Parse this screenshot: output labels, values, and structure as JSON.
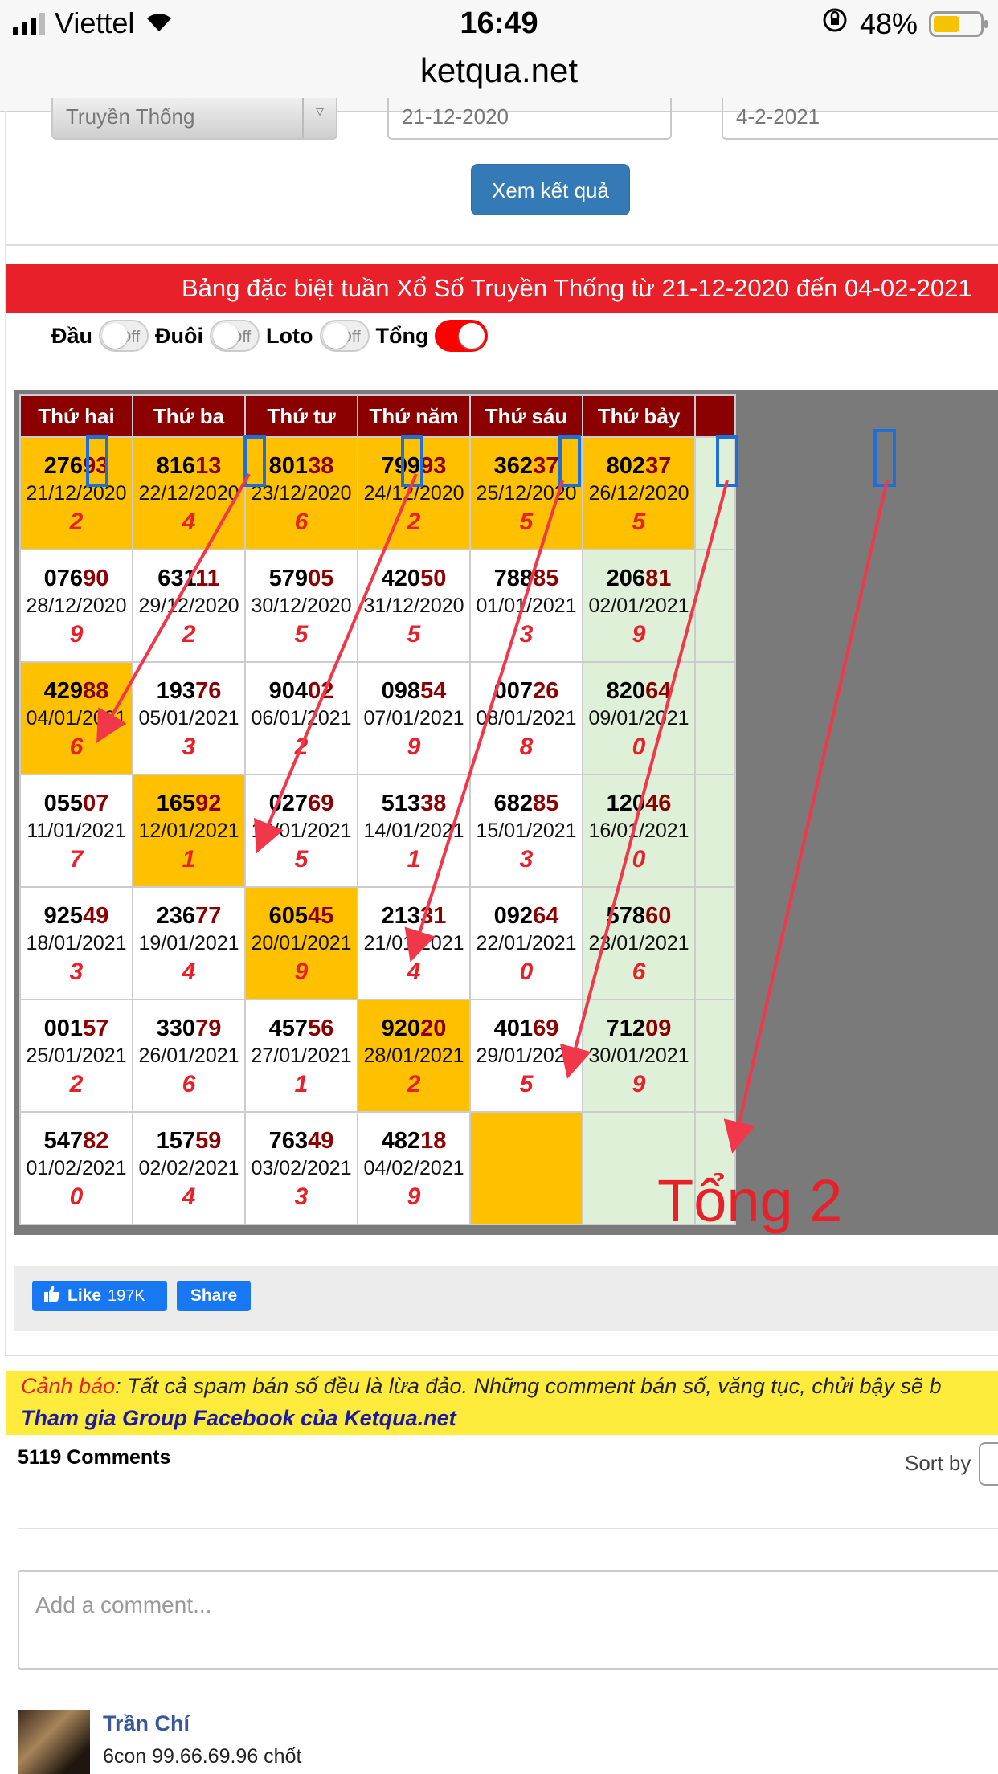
{
  "status": {
    "carrier": "Viettel",
    "time": "16:49",
    "battery": "48%",
    "battery_level": 0.48
  },
  "browser": {
    "url": "ketqua.net"
  },
  "form": {
    "type_select": "Truyền Thống",
    "date_from": "21-12-2020",
    "date_to": "4-2-2021",
    "view_button": "Xem kết quả"
  },
  "table_title": "Bảng đặc biệt tuần Xổ Số Truyền Thống từ 21-12-2020 đến 04-02-2021",
  "toggles": [
    {
      "label": "Đầu",
      "state": "Off"
    },
    {
      "label": "Đuôi",
      "state": "Off"
    },
    {
      "label": "Loto",
      "state": "Off"
    },
    {
      "label": "Tổng",
      "state": "On"
    }
  ],
  "colors": {
    "header_red": "#e8202a",
    "header_dark": "#8b0000",
    "highlight": "#ffc000",
    "weekend_green": "#dff0d8",
    "arrow": "#f0384a",
    "facebook_blue": "#1877f2"
  },
  "days": [
    "Thứ hai",
    "Thứ ba",
    "Thứ tư",
    "Thứ năm",
    "Thứ sáu",
    "Thứ bảy"
  ],
  "weeks": [
    [
      {
        "head": "276",
        "tail": "93",
        "date": "21/12/2020",
        "sum": "2",
        "hl": true
      },
      {
        "head": "816",
        "tail": "13",
        "date": "22/12/2020",
        "sum": "4",
        "hl": true
      },
      {
        "head": "801",
        "tail": "38",
        "date": "23/12/2020",
        "sum": "6",
        "hl": true
      },
      {
        "head": "799",
        "tail": "93",
        "date": "24/12/2020",
        "sum": "2",
        "hl": true
      },
      {
        "head": "362",
        "tail": "37",
        "date": "25/12/2020",
        "sum": "5",
        "hl": true
      },
      {
        "head": "802",
        "tail": "37",
        "date": "26/12/2020",
        "sum": "5",
        "hl": true
      }
    ],
    [
      {
        "head": "076",
        "tail": "90",
        "date": "28/12/2020",
        "sum": "9"
      },
      {
        "head": "631",
        "tail": "11",
        "date": "29/12/2020",
        "sum": "2"
      },
      {
        "head": "579",
        "tail": "05",
        "date": "30/12/2020",
        "sum": "5"
      },
      {
        "head": "420",
        "tail": "50",
        "date": "31/12/2020",
        "sum": "5"
      },
      {
        "head": "788",
        "tail": "85",
        "date": "01/01/2021",
        "sum": "3"
      },
      {
        "head": "206",
        "tail": "81",
        "date": "02/01/2021",
        "sum": "9",
        "gr": true
      }
    ],
    [
      {
        "head": "429",
        "tail": "88",
        "date": "04/01/2021",
        "sum": "6",
        "hl": true
      },
      {
        "head": "193",
        "tail": "76",
        "date": "05/01/2021",
        "sum": "3"
      },
      {
        "head": "904",
        "tail": "02",
        "date": "06/01/2021",
        "sum": "2"
      },
      {
        "head": "098",
        "tail": "54",
        "date": "07/01/2021",
        "sum": "9"
      },
      {
        "head": "007",
        "tail": "26",
        "date": "08/01/2021",
        "sum": "8"
      },
      {
        "head": "820",
        "tail": "64",
        "date": "09/01/2021",
        "sum": "0",
        "gr": true
      }
    ],
    [
      {
        "head": "055",
        "tail": "07",
        "date": "11/01/2021",
        "sum": "7"
      },
      {
        "head": "165",
        "tail": "92",
        "date": "12/01/2021",
        "sum": "1",
        "hl": true
      },
      {
        "head": "027",
        "tail": "69",
        "date": "13/01/2021",
        "sum": "5"
      },
      {
        "head": "513",
        "tail": "38",
        "date": "14/01/2021",
        "sum": "1"
      },
      {
        "head": "682",
        "tail": "85",
        "date": "15/01/2021",
        "sum": "3"
      },
      {
        "head": "120",
        "tail": "46",
        "date": "16/01/2021",
        "sum": "0",
        "gr": true
      }
    ],
    [
      {
        "head": "925",
        "tail": "49",
        "date": "18/01/2021",
        "sum": "3"
      },
      {
        "head": "236",
        "tail": "77",
        "date": "19/01/2021",
        "sum": "4"
      },
      {
        "head": "605",
        "tail": "45",
        "date": "20/01/2021",
        "sum": "9",
        "hl": true
      },
      {
        "head": "213",
        "tail": "31",
        "date": "21/01/2021",
        "sum": "4"
      },
      {
        "head": "092",
        "tail": "64",
        "date": "22/01/2021",
        "sum": "0"
      },
      {
        "head": "578",
        "tail": "60",
        "date": "23/01/2021",
        "sum": "6",
        "gr": true
      }
    ],
    [
      {
        "head": "001",
        "tail": "57",
        "date": "25/01/2021",
        "sum": "2"
      },
      {
        "head": "330",
        "tail": "79",
        "date": "26/01/2021",
        "sum": "6"
      },
      {
        "head": "457",
        "tail": "56",
        "date": "27/01/2021",
        "sum": "1"
      },
      {
        "head": "920",
        "tail": "20",
        "date": "28/01/2021",
        "sum": "2",
        "hl": true
      },
      {
        "head": "401",
        "tail": "69",
        "date": "29/01/2021",
        "sum": "5"
      },
      {
        "head": "712",
        "tail": "09",
        "date": "30/01/2021",
        "sum": "9",
        "gr": true
      }
    ],
    [
      {
        "head": "547",
        "tail": "82",
        "date": "01/02/2021",
        "sum": "0"
      },
      {
        "head": "157",
        "tail": "59",
        "date": "02/02/2021",
        "sum": "4"
      },
      {
        "head": "763",
        "tail": "49",
        "date": "03/02/2021",
        "sum": "3"
      },
      {
        "head": "482",
        "tail": "18",
        "date": "04/02/2021",
        "sum": "9"
      },
      {
        "empty": true,
        "hl": true
      },
      {
        "empty": true,
        "gr": true
      }
    ]
  ],
  "annotation": "Tổng 2",
  "social": {
    "like_label": "Like",
    "like_count": "197K",
    "share_label": "Share"
  },
  "warning": {
    "label": "Cảnh báo",
    "text": ": Tất cả spam bán số đều là lừa đảo. Những comment bán số, văng tục, chửi bậy sẽ b",
    "group_link": "Tham gia Group Facebook của Ketqua.net"
  },
  "comments": {
    "count": "5119 Comments",
    "sort_label": "Sort by",
    "placeholder": "Add a comment...",
    "first": {
      "author": "Trần Chí",
      "text": "6con 99.66.69.96 chốt"
    }
  }
}
